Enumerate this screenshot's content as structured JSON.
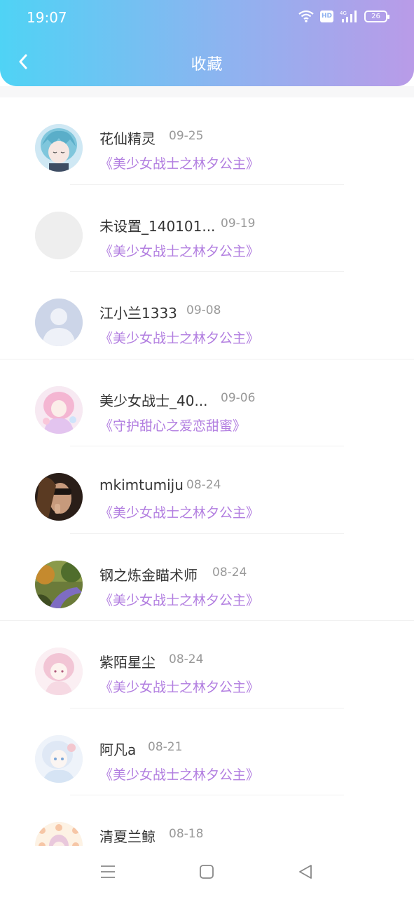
{
  "status_bar": {
    "time": "19:07",
    "hd_label": "HD",
    "network_label": "4G",
    "battery_level": "26",
    "icons": [
      "wifi-icon",
      "hd-icon",
      "signal-icon",
      "battery-icon"
    ]
  },
  "header": {
    "title": "收藏",
    "back_icon": "chevron-left-icon",
    "gradient": [
      "#4fd3f5",
      "#b99be8"
    ]
  },
  "accent_color": "#b27ee0",
  "favorites": [
    {
      "name": "花仙精灵",
      "date": "09-25",
      "work": "《美少女战士之林夕公主》",
      "avatar": "anime-avatar-blue"
    },
    {
      "name": "未设置_140101...",
      "date": "09-19",
      "work": "《美少女战士之林夕公主》",
      "avatar": "empty-avatar"
    },
    {
      "name": "江小兰1333",
      "date": "09-08",
      "work": "《美少女战士之林夕公主》",
      "avatar": "default-person-avatar"
    },
    {
      "name": "美少女战士_40...",
      "date": "09-06",
      "work": "《守护甜心之爱恋甜蜜》",
      "avatar": "anime-avatar-pink"
    },
    {
      "name": "mkimtumiju",
      "date": "08-24",
      "work": "《美少女战士之林夕公主》",
      "avatar": "photo-avatar-person"
    },
    {
      "name": "钢之炼金瞄术师",
      "date": "08-24",
      "work": "《美少女战士之林夕公主》",
      "avatar": "photo-avatar-forest"
    },
    {
      "name": "紫陌星尘",
      "date": "08-24",
      "work": "《美少女战士之林夕公主》",
      "avatar": "anime-avatar-pink-light"
    },
    {
      "name": "阿凡a",
      "date": "08-21",
      "work": "《美少女战士之林夕公主》",
      "avatar": "anime-avatar-white"
    },
    {
      "name": "清夏兰鲸",
      "date": "08-18",
      "work": "",
      "avatar": "anime-avatar-dots"
    }
  ],
  "nav_bar": {
    "buttons": [
      "menu-icon",
      "home-square-icon",
      "back-triangle-icon"
    ]
  }
}
